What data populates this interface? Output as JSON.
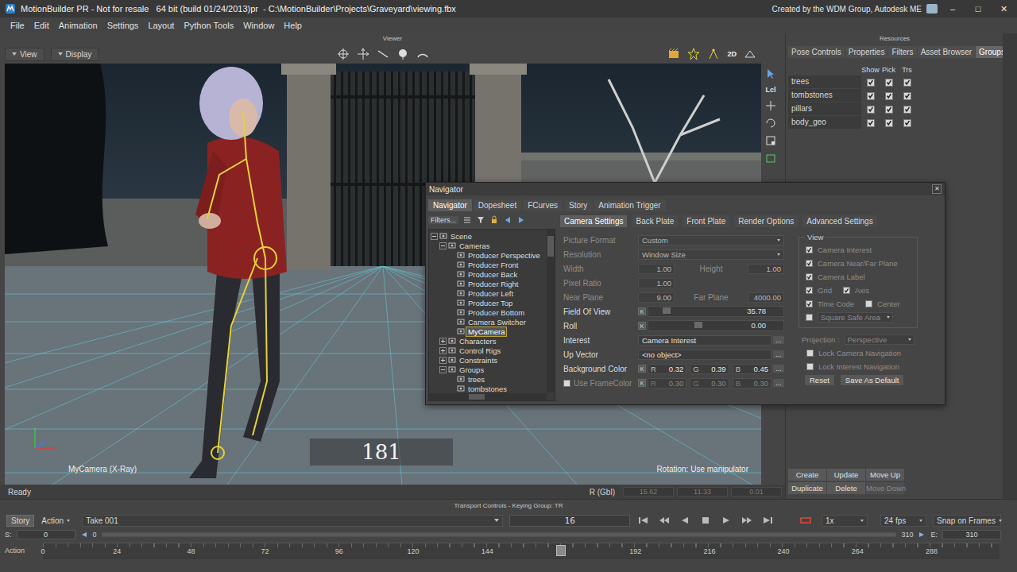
{
  "window": {
    "title": "MotionBuilder PR - Not for resale   64 bit (build 01/24/2013)pr  - C:\\MotionBuilder\\Projects\\Graveyard\\viewing.fbx",
    "credit": "Created by the WDM Group, Autodesk ME",
    "controls": [
      "–",
      "□",
      "✕"
    ]
  },
  "menu": [
    "File",
    "Edit",
    "Animation",
    "Settings",
    "Layout",
    "Python Tools",
    "Window",
    "Help"
  ],
  "viewer": {
    "label": "Viewer",
    "menus": [
      "View",
      "Display"
    ],
    "toolbar_text": "2D",
    "side_tool_text": "Lcl",
    "camera_label": "MyCamera (X-Ray)",
    "frame": "181",
    "hint": "Rotation: Use manipulator"
  },
  "status_bar": {
    "text": "Ready",
    "reference": "R (Gbl)",
    "values": [
      "15.62",
      "11.33",
      "0.01"
    ]
  },
  "resources": {
    "label": "Resources",
    "tabs": [
      {
        "label": "Pose Controls",
        "selected": false
      },
      {
        "label": "Properties",
        "selected": false
      },
      {
        "label": "Filters",
        "selected": false
      },
      {
        "label": "Asset Browser",
        "selected": false
      },
      {
        "label": "Groups",
        "selected": true
      }
    ],
    "columns": [
      "Show",
      "Pick",
      "Trs"
    ],
    "groups": [
      {
        "name": "trees",
        "show": true,
        "pick": true,
        "trs": true
      },
      {
        "name": "tombstones",
        "show": true,
        "pick": true,
        "trs": true
      },
      {
        "name": "pillars",
        "show": true,
        "pick": true,
        "trs": true
      },
      {
        "name": "body_geo",
        "show": true,
        "pick": true,
        "trs": true
      }
    ],
    "buttons": [
      {
        "label": "Create",
        "disabled": false
      },
      {
        "label": "Update",
        "disabled": false
      },
      {
        "label": "Move Up",
        "disabled": false
      },
      {
        "label": "Duplicate",
        "disabled": false
      },
      {
        "label": "Delete",
        "disabled": false
      },
      {
        "label": "Move Down",
        "disabled": true
      }
    ]
  },
  "navigator": {
    "title": "Navigator",
    "close": "✕",
    "ellipsis": "...",
    "key": "K",
    "tabs": [
      {
        "label": "Navigator",
        "selected": true
      },
      {
        "label": "Dopesheet",
        "selected": false
      },
      {
        "label": "FCurves",
        "selected": false
      },
      {
        "label": "Story",
        "selected": false
      },
      {
        "label": "Animation Trigger",
        "selected": false
      }
    ],
    "filters": "Filters...",
    "tree": [
      {
        "label": "Scene",
        "depth": 0,
        "has_children": true,
        "expanded": true,
        "selected": false
      },
      {
        "label": "Cameras",
        "depth": 1,
        "has_children": true,
        "expanded": true,
        "selected": false
      },
      {
        "label": "Producer Perspective",
        "depth": 2,
        "has_children": false,
        "expanded": false,
        "selected": false
      },
      {
        "label": "Producer Front",
        "depth": 2,
        "has_children": false,
        "expanded": false,
        "selected": false
      },
      {
        "label": "Producer Back",
        "depth": 2,
        "has_children": false,
        "expanded": false,
        "selected": false
      },
      {
        "label": "Producer Right",
        "depth": 2,
        "has_children": false,
        "expanded": false,
        "selected": false
      },
      {
        "label": "Producer Left",
        "depth": 2,
        "has_children": false,
        "expanded": false,
        "selected": false
      },
      {
        "label": "Producer Top",
        "depth": 2,
        "has_children": false,
        "expanded": false,
        "selected": false
      },
      {
        "label": "Producer Bottom",
        "depth": 2,
        "has_children": false,
        "expanded": false,
        "selected": false
      },
      {
        "label": "Camera Switcher",
        "depth": 2,
        "has_children": false,
        "expanded": false,
        "selected": false
      },
      {
        "label": "MyCamera",
        "depth": 2,
        "has_children": false,
        "expanded": false,
        "selected": true
      },
      {
        "label": "Characters",
        "depth": 1,
        "has_children": true,
        "expanded": false,
        "selected": false
      },
      {
        "label": "Control Rigs",
        "depth": 1,
        "has_children": true,
        "expanded": false,
        "selected": false
      },
      {
        "label": "Constraints",
        "depth": 1,
        "has_children": true,
        "expanded": false,
        "selected": false
      },
      {
        "label": "Groups",
        "depth": 1,
        "has_children": true,
        "expanded": true,
        "selected": false
      },
      {
        "label": "trees",
        "depth": 2,
        "has_children": false,
        "expanded": false,
        "selected": false
      },
      {
        "label": "tombstones",
        "depth": 2,
        "has_children": false,
        "expanded": false,
        "selected": false
      }
    ],
    "subtabs": [
      {
        "label": "Camera Settings",
        "selected": true
      },
      {
        "label": "Back Plate",
        "selected": false
      },
      {
        "label": "Front Plate",
        "selected": false
      },
      {
        "label": "Render Options",
        "selected": false
      },
      {
        "label": "Advanced Settings",
        "selected": false
      }
    ],
    "fields": [
      {
        "kind": "dropdown",
        "label": "Picture Format",
        "value": "Custom",
        "disabled": true
      },
      {
        "kind": "dropdown",
        "label": "Resolution",
        "value": "Window Size",
        "disabled": true
      },
      {
        "kind": "pair",
        "label": "Width",
        "value": "1.00",
        "label2": "Height",
        "value2": "1.00",
        "disabled": true
      },
      {
        "kind": "single",
        "label": "Pixel Ratio",
        "value": "1.00",
        "disabled": true
      },
      {
        "kind": "pair",
        "label": "Near Plane",
        "value": "9.00",
        "label2": "Far Plane",
        "value2": "4000.00",
        "disabled": true
      },
      {
        "kind": "slider",
        "label": "Field Of View",
        "value": "35.78",
        "level": 0.12,
        "disabled": false
      },
      {
        "kind": "slider",
        "label": "Roll",
        "value": "0.00",
        "level": 0.35,
        "disabled": false
      },
      {
        "kind": "link",
        "label": "Interest",
        "value": "Camera Interest",
        "disabled": false
      },
      {
        "kind": "link",
        "label": "Up Vector",
        "value": "<no object>",
        "disabled": false
      },
      {
        "kind": "color",
        "label": "Background Color",
        "has_checkbox": false,
        "checked": false,
        "channels": [
          {
            "name": "R",
            "value": "0.32"
          },
          {
            "name": "G",
            "value": "0.39"
          },
          {
            "name": "B",
            "value": "0.45"
          }
        ],
        "disabled": false
      },
      {
        "kind": "color",
        "label": "Use FrameColor",
        "has_checkbox": true,
        "checked": false,
        "channels": [
          {
            "name": "R",
            "value": "0.30"
          },
          {
            "name": "G",
            "value": "0.30"
          },
          {
            "name": "B",
            "value": "0.30"
          }
        ],
        "disabled": true
      }
    ],
    "view": {
      "label": "View",
      "disabled": true,
      "rows": [
        [
          {
            "label": "Camera Interest",
            "checked": true
          }
        ],
        [
          {
            "label": "Camera Near/Far Plane",
            "checked": true
          }
        ],
        [
          {
            "label": "Camera Label",
            "checked": true
          }
        ],
        [
          {
            "label": "Grid",
            "checked": true
          },
          {
            "label": "Axis",
            "checked": true
          }
        ],
        [
          {
            "label": "Time Code",
            "checked": true
          },
          {
            "label": "Center",
            "checked": false
          }
        ]
      ],
      "safe_area": {
        "checked": false,
        "value": "Square Safe Area"
      },
      "projection": {
        "label": "Projection :",
        "value": "Perspective"
      },
      "locks": [
        {
          "label": "Lock Camera Navigation",
          "checked": false
        },
        {
          "label": "Lock Interest Navigation",
          "checked": false
        }
      ]
    },
    "buttons": [
      "Reset",
      "Save As Default"
    ]
  },
  "transport": {
    "title": "Transport Controls - Keying Group: TR",
    "modes": [
      {
        "label": "Story",
        "selected": true
      },
      {
        "label": "Action",
        "selected": false
      }
    ],
    "take": "Take 001",
    "timecode": "16",
    "speed": "1x",
    "fps": "24 fps",
    "snap": "Snap on Frames",
    "start_label": "S:",
    "start": "0",
    "zoom_start": "0",
    "zoom_end": "310",
    "end_label": "E:",
    "end": "310",
    "track_label": "Action",
    "ticks": [
      {
        "label": "0",
        "frame": 0
      },
      {
        "label": "24",
        "frame": 24
      },
      {
        "label": "48",
        "frame": 48
      },
      {
        "label": "72",
        "frame": 72
      },
      {
        "label": "96",
        "frame": 96
      },
      {
        "label": "120",
        "frame": 120
      },
      {
        "label": "144",
        "frame": 144
      },
      {
        "label": "192",
        "frame": 192
      },
      {
        "label": "216",
        "frame": 216
      },
      {
        "label": "240",
        "frame": 240
      },
      {
        "label": "264",
        "frame": 264
      },
      {
        "label": "288",
        "frame": 288
      }
    ],
    "playhead_frame": 168
  }
}
